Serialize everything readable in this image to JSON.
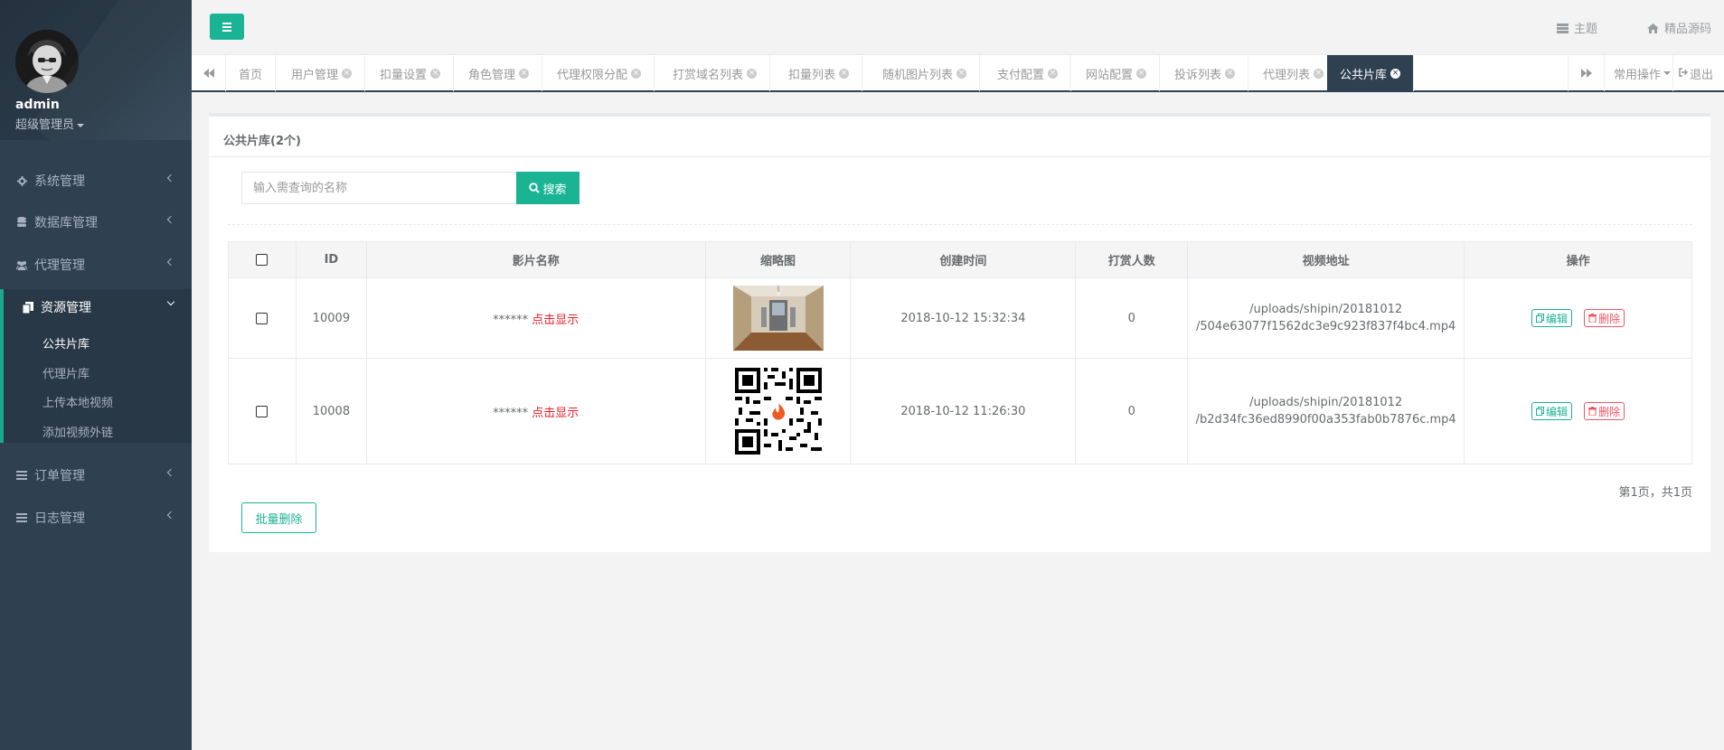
{
  "profile": {
    "name": "admin",
    "role": "超级管理员"
  },
  "sidebar": {
    "items": [
      {
        "label": "系统管理",
        "icon": "gear-icon"
      },
      {
        "label": "数据库管理",
        "icon": "database-icon"
      },
      {
        "label": "代理管理",
        "icon": "users-icon"
      },
      {
        "label": "资源管理",
        "icon": "files-icon"
      },
      {
        "label": "订单管理",
        "icon": "list-icon"
      },
      {
        "label": "日志管理",
        "icon": "list-icon"
      }
    ],
    "sub_items": [
      {
        "label": "公共片库"
      },
      {
        "label": "代理片库"
      },
      {
        "label": "上传本地视频"
      },
      {
        "label": "添加视频外链"
      }
    ]
  },
  "topbar": {
    "theme_label": "主题",
    "source_label": "精品源码"
  },
  "tabs": {
    "items": [
      {
        "label": "首页"
      },
      {
        "label": "用户管理"
      },
      {
        "label": "扣量设置"
      },
      {
        "label": "角色管理"
      },
      {
        "label": "代理权限分配"
      },
      {
        "label": "打赏域名列表"
      },
      {
        "label": "扣量列表"
      },
      {
        "label": "随机图片列表"
      },
      {
        "label": "支付配置"
      },
      {
        "label": "网站配置"
      },
      {
        "label": "投诉列表"
      },
      {
        "label": "代理列表"
      },
      {
        "label": "公共片库"
      }
    ],
    "common_ops": "常用操作",
    "logout": "退出"
  },
  "panel": {
    "title": "公共片库(2个)",
    "search_placeholder": "输入需查询的名称",
    "search_button": "搜索",
    "columns": [
      "ID",
      "影片名称",
      "缩略图",
      "创建时间",
      "打赏人数",
      "视频地址",
      "操作"
    ],
    "rows": [
      {
        "id": "10009",
        "name_masked": "******",
        "reveal": "点击显示",
        "created": "2018-10-12 15:32:34",
        "tips": "0",
        "path_line1": "/uploads/shipin/20181012",
        "path_line2": "/504e63077f1562dc3e9c923f837f4bc4.mp4"
      },
      {
        "id": "10008",
        "name_masked": "******",
        "reveal": "点击显示",
        "created": "2018-10-12 11:26:30",
        "tips": "0",
        "path_line1": "/uploads/shipin/20181012",
        "path_line2": "/b2d34fc36ed8990f00a353fab0b7876c.mp4"
      }
    ],
    "edit_label": "编辑",
    "delete_label": "删除",
    "pager": "第1页，共1页",
    "batch_delete": "批量删除"
  },
  "colors": {
    "accent": "#1ab394",
    "sidebar": "#2f4050",
    "danger": "#ed5565",
    "reveal": "#ed1c24"
  }
}
